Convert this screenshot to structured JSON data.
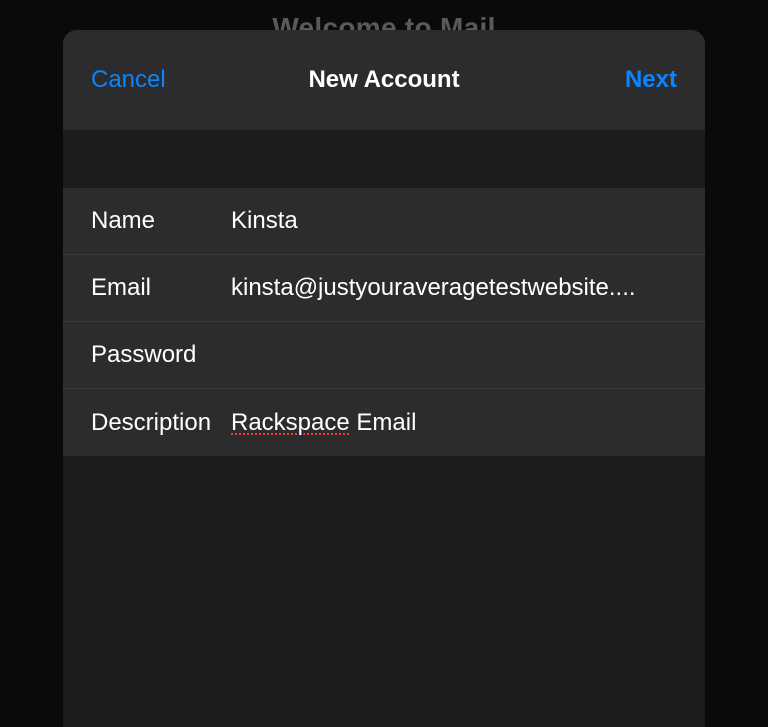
{
  "background": {
    "title": "Welcome to Mail"
  },
  "modal": {
    "cancel_label": "Cancel",
    "title": "New Account",
    "next_label": "Next"
  },
  "form": {
    "name": {
      "label": "Name",
      "value": "Kinsta"
    },
    "email": {
      "label": "Email",
      "value": "kinsta@justyouraveragetestwebsite...."
    },
    "password": {
      "label": "Password",
      "value": ""
    },
    "description": {
      "label": "Description",
      "value_word1": "Rackspace",
      "value_word2": " Email"
    }
  }
}
